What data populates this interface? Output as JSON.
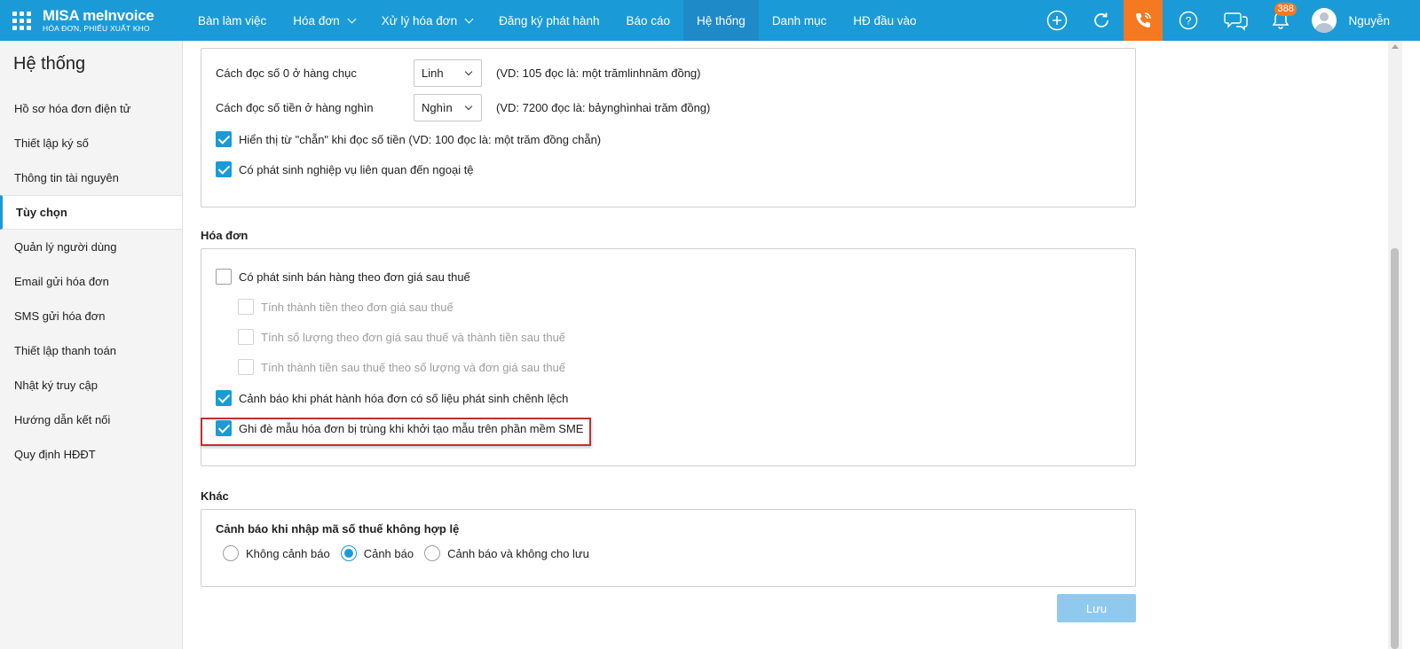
{
  "brand": {
    "name": "MISA meInvoice",
    "tagline": "HÓA ĐƠN, PHIẾU XUẤT KHO"
  },
  "nav": {
    "items": [
      {
        "label": "Bàn làm việc",
        "dropdown": false
      },
      {
        "label": "Hóa đơn",
        "dropdown": true
      },
      {
        "label": "Xử lý hóa đơn",
        "dropdown": true
      },
      {
        "label": "Đăng ký phát hành",
        "dropdown": false
      },
      {
        "label": "Báo cáo",
        "dropdown": false
      },
      {
        "label": "Hệ thống",
        "dropdown": false,
        "active": true
      },
      {
        "label": "Danh mục",
        "dropdown": false
      },
      {
        "label": "HĐ đầu vào",
        "dropdown": false
      }
    ]
  },
  "topright": {
    "notification_count": "388",
    "user_name": "Nguyễn"
  },
  "sidebar": {
    "title": "Hệ thống",
    "items": [
      {
        "label": "Hồ sơ hóa đơn điện tử"
      },
      {
        "label": "Thiết lập ký số"
      },
      {
        "label": "Thông tin tài nguyên"
      },
      {
        "label": "Tùy chọn",
        "active": true
      },
      {
        "label": "Quản lý người dùng"
      },
      {
        "label": "Email gửi hóa đơn"
      },
      {
        "label": "SMS gửi hóa đơn"
      },
      {
        "label": "Thiết lập thanh toán"
      },
      {
        "label": "Nhật ký truy cập"
      },
      {
        "label": "Hướng dẫn kết nối"
      },
      {
        "label": "Quy định HĐĐT"
      }
    ]
  },
  "reading": {
    "zero_tens_label": "Cách đọc số 0 ở hàng chục",
    "zero_tens_value": "Linh",
    "zero_tens_hint": "(VD: 105 đọc là: một trămlinhnăm đồng)",
    "thousands_label": "Cách đọc số tiền ở hàng nghìn",
    "thousands_value": "Nghìn",
    "thousands_hint": "(VD: 7200 đọc là: bảynghìnhai trăm đồng)",
    "show_chan_label": "Hiển thị từ \"chẵn\" khi đọc số tiền (VD: 100 đọc là: một trăm đồng chẵn)",
    "foreign_currency_label": "Có phát sinh nghiệp vụ liên quan đến ngoại tệ"
  },
  "invoice": {
    "title": "Hóa đơn",
    "after_tax_label": "Có phát sinh bán hàng theo đơn giá sau thuế",
    "sub1": "Tính thành tiền theo đơn giá sau thuế",
    "sub2": "Tính số lượng theo đơn giá sau thuế và thành tiền sau thuế",
    "sub3": "Tính thành tiền sau thuế theo số lượng và đơn giá sau thuế",
    "warn_diff_label": "Cảnh báo khi phát hành hóa đơn có số liệu phát sinh chênh lệch",
    "overwrite_label": "Ghi đè mẫu hóa đơn bị trùng khi khởi tạo mẫu trên phần mềm SME"
  },
  "other": {
    "title": "Khác",
    "tax_code_title": "Cảnh báo khi nhập mã số thuế không hợp lệ",
    "opt_none": "Không cảnh báo",
    "opt_warn": "Cảnh báo",
    "opt_warn_block": "Cảnh báo và không cho lưu"
  },
  "save_label": "Lưu",
  "colors": {
    "primary": "#1a9bd7",
    "phone": "#f47920",
    "highlight": "#c0312f"
  }
}
